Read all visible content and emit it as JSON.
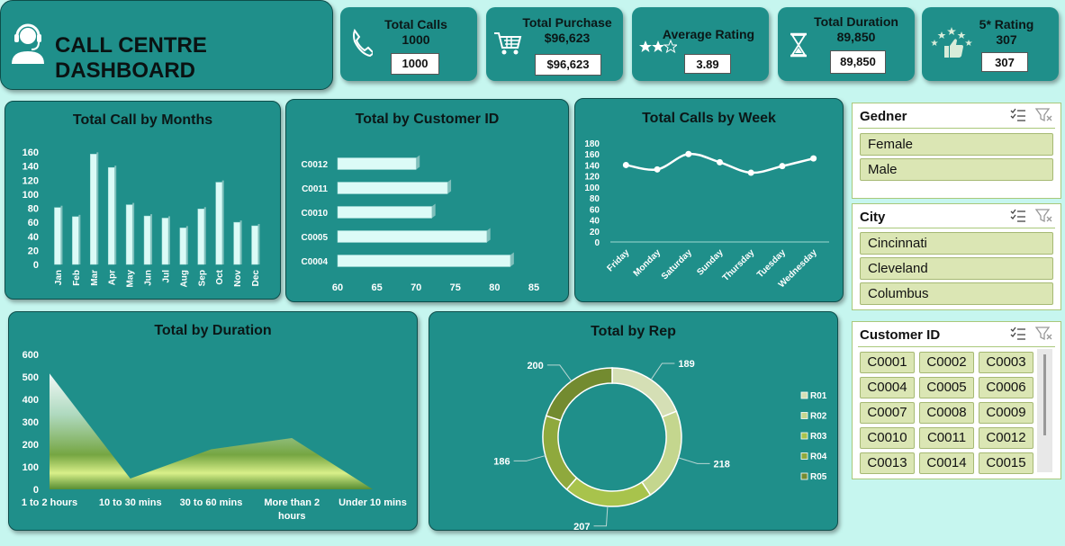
{
  "header": {
    "title": "CALL CENTRE DASHBOARD",
    "icon": "headset-agent-icon"
  },
  "kpis": {
    "calls": {
      "title_line1": "Total Calls",
      "title_line2": "1000",
      "value": "1000",
      "icon": "phone-icon"
    },
    "purchase": {
      "title_line1": "Total Purchase",
      "title_line2": "$96,623",
      "value": "$96,623",
      "icon": "shopping-cart-icon"
    },
    "rating": {
      "title_line1": "Average Rating",
      "value": "3.89",
      "icon": "stars-rating-icon"
    },
    "duration": {
      "title_line1": "Total Duration",
      "title_line2": "89,850",
      "value": "89,850",
      "icon": "hourglass-icon"
    },
    "five_star": {
      "title_line1": "5* Rating",
      "title_line2": "307",
      "value": "307",
      "icon": "thumbs-up-stars-icon"
    }
  },
  "colors": {
    "panel": "#1f8f8a",
    "background": "#c6f6ef",
    "accent_light": "#dbe6b4",
    "line": "#ffffff"
  },
  "slicers": {
    "gender": {
      "title": "Gedner",
      "items": [
        "Female",
        "Male"
      ]
    },
    "city": {
      "title": "City",
      "items": [
        "Cincinnati",
        "Cleveland",
        "Columbus"
      ]
    },
    "customer": {
      "title": "Customer ID",
      "items": [
        "C0001",
        "C0002",
        "C0003",
        "C0004",
        "C0005",
        "C0006",
        "C0007",
        "C0008",
        "C0009",
        "C0010",
        "C0011",
        "C0012",
        "C0013",
        "C0014",
        "C0015"
      ]
    }
  },
  "chart_data": [
    {
      "id": "months",
      "type": "bar",
      "title": "Total Call by Months",
      "categories": [
        "Jan",
        "Feb",
        "Mar",
        "Apr",
        "May",
        "Jun",
        "Jul",
        "Aug",
        "Sep",
        "Oct",
        "Nov",
        "Dec"
      ],
      "values": [
        81,
        68,
        157,
        138,
        85,
        69,
        66,
        52,
        79,
        117,
        60,
        55
      ],
      "ylim": [
        0,
        160
      ],
      "yticks": [
        0,
        20,
        40,
        60,
        80,
        100,
        120,
        140,
        160
      ]
    },
    {
      "id": "customer",
      "type": "bar",
      "orientation": "horizontal",
      "title": "Total by Customer ID",
      "categories": [
        "C0012",
        "C0011",
        "C0010",
        "C0005",
        "C0004"
      ],
      "values": [
        70,
        74,
        72,
        79,
        82
      ],
      "xlim": [
        60,
        85
      ],
      "xticks": [
        60,
        65,
        70,
        75,
        80,
        85
      ]
    },
    {
      "id": "week",
      "type": "line",
      "title": "Total Calls by Week",
      "categories": [
        "Friday",
        "Monday",
        "Saturday",
        "Sunday",
        "Thursday",
        "Tuesday",
        "Wednesday"
      ],
      "values": [
        140,
        132,
        160,
        145,
        126,
        138,
        152
      ],
      "ylim": [
        0,
        180
      ],
      "yticks": [
        0,
        20,
        40,
        60,
        80,
        100,
        120,
        140,
        160,
        180
      ]
    },
    {
      "id": "duration",
      "type": "area",
      "title": "Total by Duration",
      "categories": [
        "1 to 2 hours",
        "10 to 30 mins",
        "30 to 60 mins",
        "More than 2 hours",
        "Under 10 mins"
      ],
      "values": [
        515,
        48,
        178,
        228,
        0
      ],
      "ylim": [
        0,
        600
      ],
      "yticks": [
        0,
        100,
        200,
        300,
        400,
        500,
        600
      ]
    },
    {
      "id": "rep",
      "type": "pie",
      "style": "donut",
      "title": "Total by Rep",
      "series": [
        {
          "name": "R01",
          "value": 189,
          "color": "#d5dfb5"
        },
        {
          "name": "R02",
          "value": 218,
          "color": "#c4d68e"
        },
        {
          "name": "R03",
          "value": 207,
          "color": "#a8c34c"
        },
        {
          "name": "R04",
          "value": 186,
          "color": "#8fa93d"
        },
        {
          "name": "R05",
          "value": 200,
          "color": "#738b30"
        }
      ],
      "legend": "right"
    }
  ]
}
